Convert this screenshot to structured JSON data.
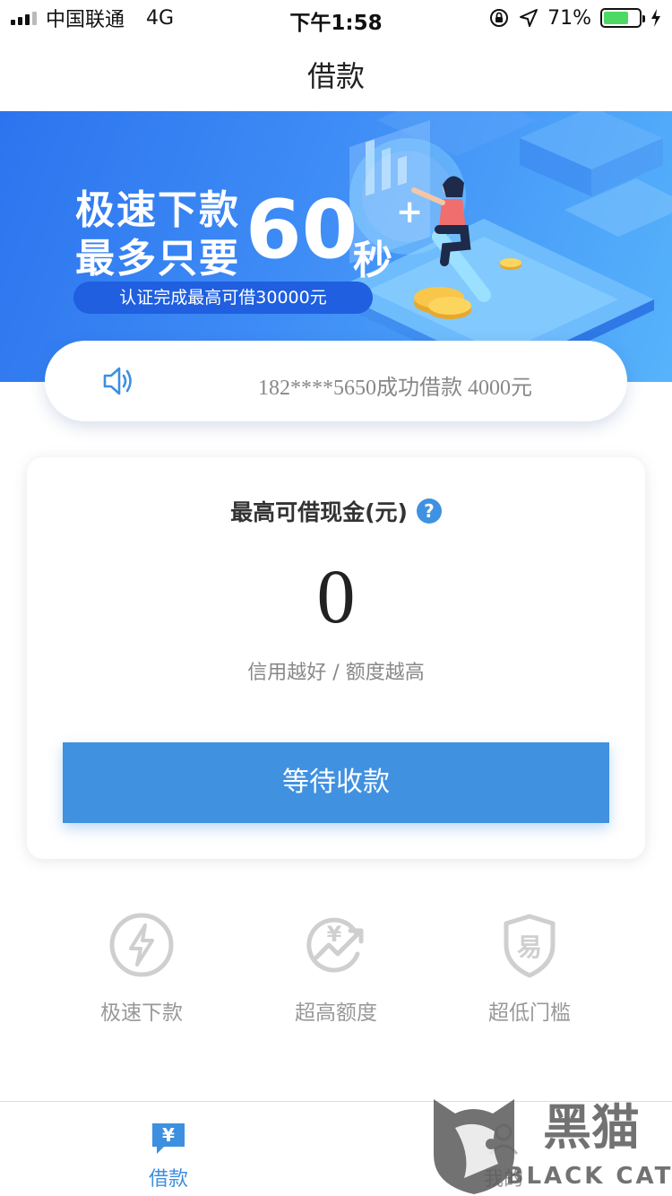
{
  "status_bar": {
    "carrier": "中国联通",
    "network": "4G",
    "time": "下午1:58",
    "battery_percent_text": "71%",
    "battery_level": 0.71,
    "battery_color": "#4cd964"
  },
  "nav": {
    "title": "借款"
  },
  "banner": {
    "line1": "极速下款",
    "line2": "最多只要",
    "big_number": "60",
    "unit": "秒",
    "plus": "+",
    "pill": "认证完成最高可借30000元",
    "colors": {
      "start": "#2c74ee",
      "end": "#57b3fb"
    }
  },
  "notice": {
    "icon": "speaker-icon",
    "text": "182****5650成功借款 4000元"
  },
  "card": {
    "title": "最高可借现金(元)",
    "help_icon": "question-icon",
    "help_glyph": "?",
    "amount": "0",
    "subtitle": "信用越好 / 额度越高",
    "button_label": "等待收款",
    "accent": "#4191e1"
  },
  "features": [
    {
      "label": "极速下款",
      "icon": "lightning-icon"
    },
    {
      "label": "超高额度",
      "icon": "yen-growth-icon"
    },
    {
      "label": "超低门槛",
      "icon": "shield-easy-icon"
    }
  ],
  "feature_icon_glyphs": {
    "yen": "¥",
    "easy": "易"
  },
  "tabbar": {
    "tabs": [
      {
        "label": "借款",
        "icon": "yen-chat-icon",
        "active": true,
        "glyph": "¥"
      },
      {
        "label": "我的",
        "icon": "profile-icon",
        "active": false
      }
    ]
  },
  "watermark": {
    "title": "黑猫",
    "subtitle": "BLACK CAT"
  }
}
